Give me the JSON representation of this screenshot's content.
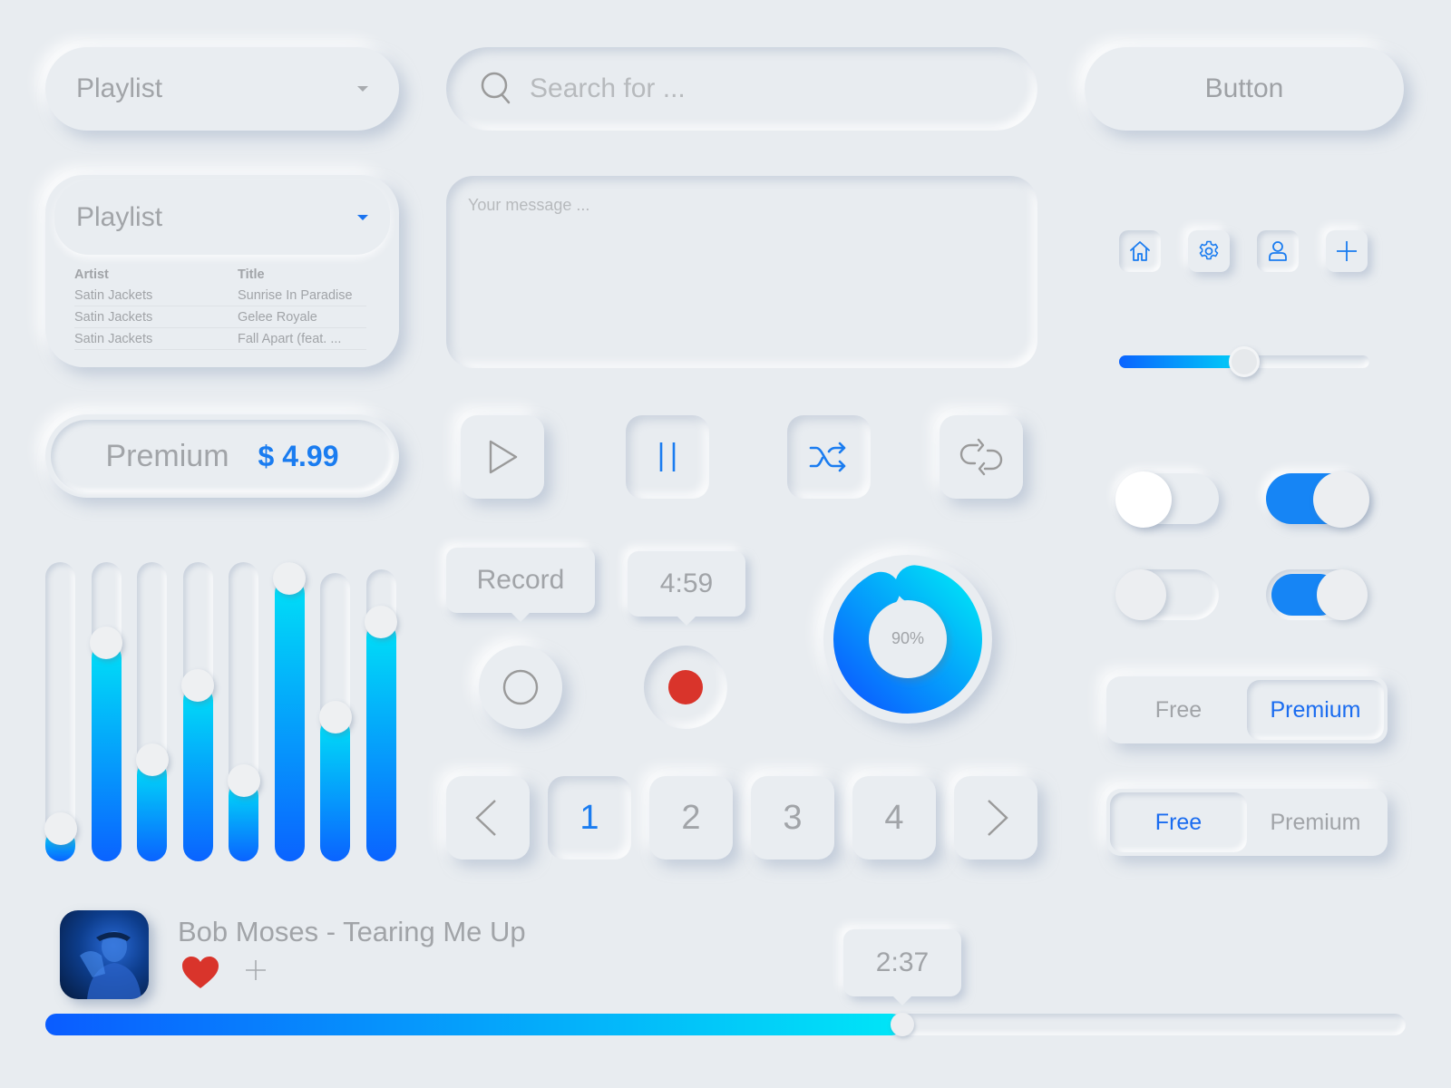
{
  "dropdown_collapsed": {
    "label": "Playlist",
    "icon": "caret-down-icon"
  },
  "dropdown_expanded": {
    "label": "Playlist",
    "icon": "caret-down-icon",
    "columns": [
      "Artist",
      "Title"
    ],
    "rows": [
      [
        "Satin Jackets",
        "Sunrise In Paradise"
      ],
      [
        "Satin Jackets",
        "Gelee Royale"
      ],
      [
        "Satin Jackets",
        "Fall Apart (feat. ..."
      ]
    ]
  },
  "price_tag": {
    "label": "Premium",
    "price": "$ 4.99"
  },
  "equalizer": {
    "levels": [
      0.06,
      0.76,
      0.32,
      0.6,
      0.24,
      1.0,
      0.5,
      0.86
    ]
  },
  "search": {
    "placeholder": "Search for ...",
    "value": ""
  },
  "message": {
    "placeholder": "Your message ...",
    "value": ""
  },
  "button": {
    "label": "Button"
  },
  "icon_buttons": [
    {
      "icon": "home-icon",
      "pressed": true
    },
    {
      "icon": "gear-icon",
      "pressed": false
    },
    {
      "icon": "user-icon",
      "pressed": true
    },
    {
      "icon": "plus-icon",
      "pressed": false
    }
  ],
  "volume_slider": {
    "value": 0.5
  },
  "media_buttons": [
    {
      "icon": "play-icon",
      "active": false
    },
    {
      "icon": "pause-icon",
      "active": true
    },
    {
      "icon": "shuffle-icon",
      "active": true
    },
    {
      "icon": "repeat-icon",
      "active": false
    }
  ],
  "record": {
    "tooltip": "Record",
    "timer": "4:59",
    "idle_icon": "record-idle-icon",
    "active_icon": "record-active-icon",
    "record_color": "#d9342b"
  },
  "progress_ring": {
    "value": 90,
    "label": "90%"
  },
  "pagination": {
    "prev_icon": "chevron-left-icon",
    "next_icon": "chevron-right-icon",
    "pages": [
      "1",
      "2",
      "3",
      "4"
    ],
    "current": "1"
  },
  "toggles": [
    {
      "on": false,
      "style": "raised"
    },
    {
      "on": true,
      "style": "raised"
    },
    {
      "on": false,
      "style": "inset"
    },
    {
      "on": true,
      "style": "inset"
    }
  ],
  "segmented": [
    {
      "options": [
        "Free",
        "Premium"
      ],
      "selected": "Premium"
    },
    {
      "options": [
        "Free",
        "Premium"
      ],
      "selected": "Free"
    }
  ],
  "now_playing": {
    "title": "Bob Moses - Tearing Me Up",
    "elapsed": "2:37",
    "progress": 0.63,
    "liked": true,
    "heart_color": "#d9342b"
  },
  "colors": {
    "accent": "#1a7cf0",
    "gradient_start": "#0a63ff",
    "gradient_end": "#00e1f7",
    "background": "#e8ecf0"
  }
}
